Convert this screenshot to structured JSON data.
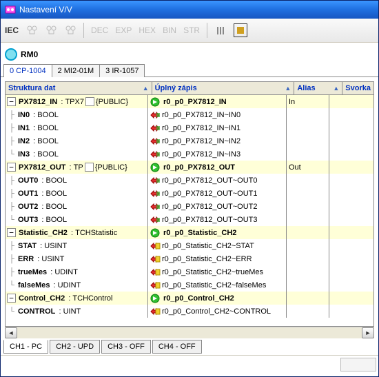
{
  "window": {
    "title": "Nastavení V/V"
  },
  "toolbar": {
    "iec": "IEC",
    "dec": "DEC",
    "exp": "EXP",
    "hex": "HEX",
    "bin": "BIN",
    "str": "STR"
  },
  "module": {
    "name": "RM0"
  },
  "tabs": [
    {
      "label": "0  CP-1004",
      "active": true
    },
    {
      "label": "2  MI2-01M"
    },
    {
      "label": "3  IR-1057"
    }
  ],
  "columns": {
    "c1": "Struktura dat",
    "c2": "Úplný zápis",
    "c3": "Alias",
    "c4": "Svorka"
  },
  "groups": [
    {
      "name": "PX7812_IN",
      "type": "TPX7",
      "pub": "{PUBLIC}",
      "full": "r0_p0_PX7812_IN",
      "alias": "In",
      "rows": [
        {
          "name": "IN0",
          "type": "BOOL",
          "full": "r0_p0_PX7812_IN~IN0",
          "icon": "red"
        },
        {
          "name": "IN1",
          "type": "BOOL",
          "full": "r0_p0_PX7812_IN~IN1",
          "icon": "red"
        },
        {
          "name": "IN2",
          "type": "BOOL",
          "full": "r0_p0_PX7812_IN~IN2",
          "icon": "red"
        },
        {
          "name": "IN3",
          "type": "BOOL",
          "full": "r0_p0_PX7812_IN~IN3",
          "icon": "red"
        }
      ]
    },
    {
      "name": "PX7812_OUT",
      "type": "TP",
      "pub": "{PUBLIC}",
      "full": "r0_p0_PX7812_OUT",
      "alias": "Out",
      "rows": [
        {
          "name": "OUT0",
          "type": "BOOL",
          "full": "r0_p0_PX7812_OUT~OUT0",
          "icon": "red"
        },
        {
          "name": "OUT1",
          "type": "BOOL",
          "full": "r0_p0_PX7812_OUT~OUT1",
          "icon": "red"
        },
        {
          "name": "OUT2",
          "type": "BOOL",
          "full": "r0_p0_PX7812_OUT~OUT2",
          "icon": "red"
        },
        {
          "name": "OUT3",
          "type": "BOOL",
          "full": "r0_p0_PX7812_OUT~OUT3",
          "icon": "red"
        }
      ]
    },
    {
      "name": "Statistic_CH2",
      "type": "TCHStatistic",
      "pub": "",
      "full": "r0_p0_Statistic_CH2",
      "alias": "",
      "rows": [
        {
          "name": "STAT",
          "type": "USINT",
          "full": "r0_p0_Statistic_CH2~STAT",
          "icon": "yel"
        },
        {
          "name": "ERR",
          "type": "USINT",
          "full": "r0_p0_Statistic_CH2~ERR",
          "icon": "yel"
        },
        {
          "name": "trueMes",
          "type": "UDINT",
          "full": "r0_p0_Statistic_CH2~trueMes",
          "icon": "yel"
        },
        {
          "name": "falseMes",
          "type": "UDINT",
          "full": "r0_p0_Statistic_CH2~falseMes",
          "icon": "yel"
        }
      ]
    },
    {
      "name": "Control_CH2",
      "type": "TCHControl",
      "pub": "",
      "full": "r0_p0_Control_CH2",
      "alias": "",
      "rows": [
        {
          "name": "CONTROL",
          "type": "UINT",
          "full": "r0_p0_Control_CH2~CONTROL",
          "icon": "yel"
        }
      ]
    }
  ],
  "bottomtabs": [
    {
      "label": "CH1 - PC",
      "active": true
    },
    {
      "label": "CH2 - UPD"
    },
    {
      "label": "CH3 - OFF"
    },
    {
      "label": "CH4 - OFF"
    }
  ]
}
